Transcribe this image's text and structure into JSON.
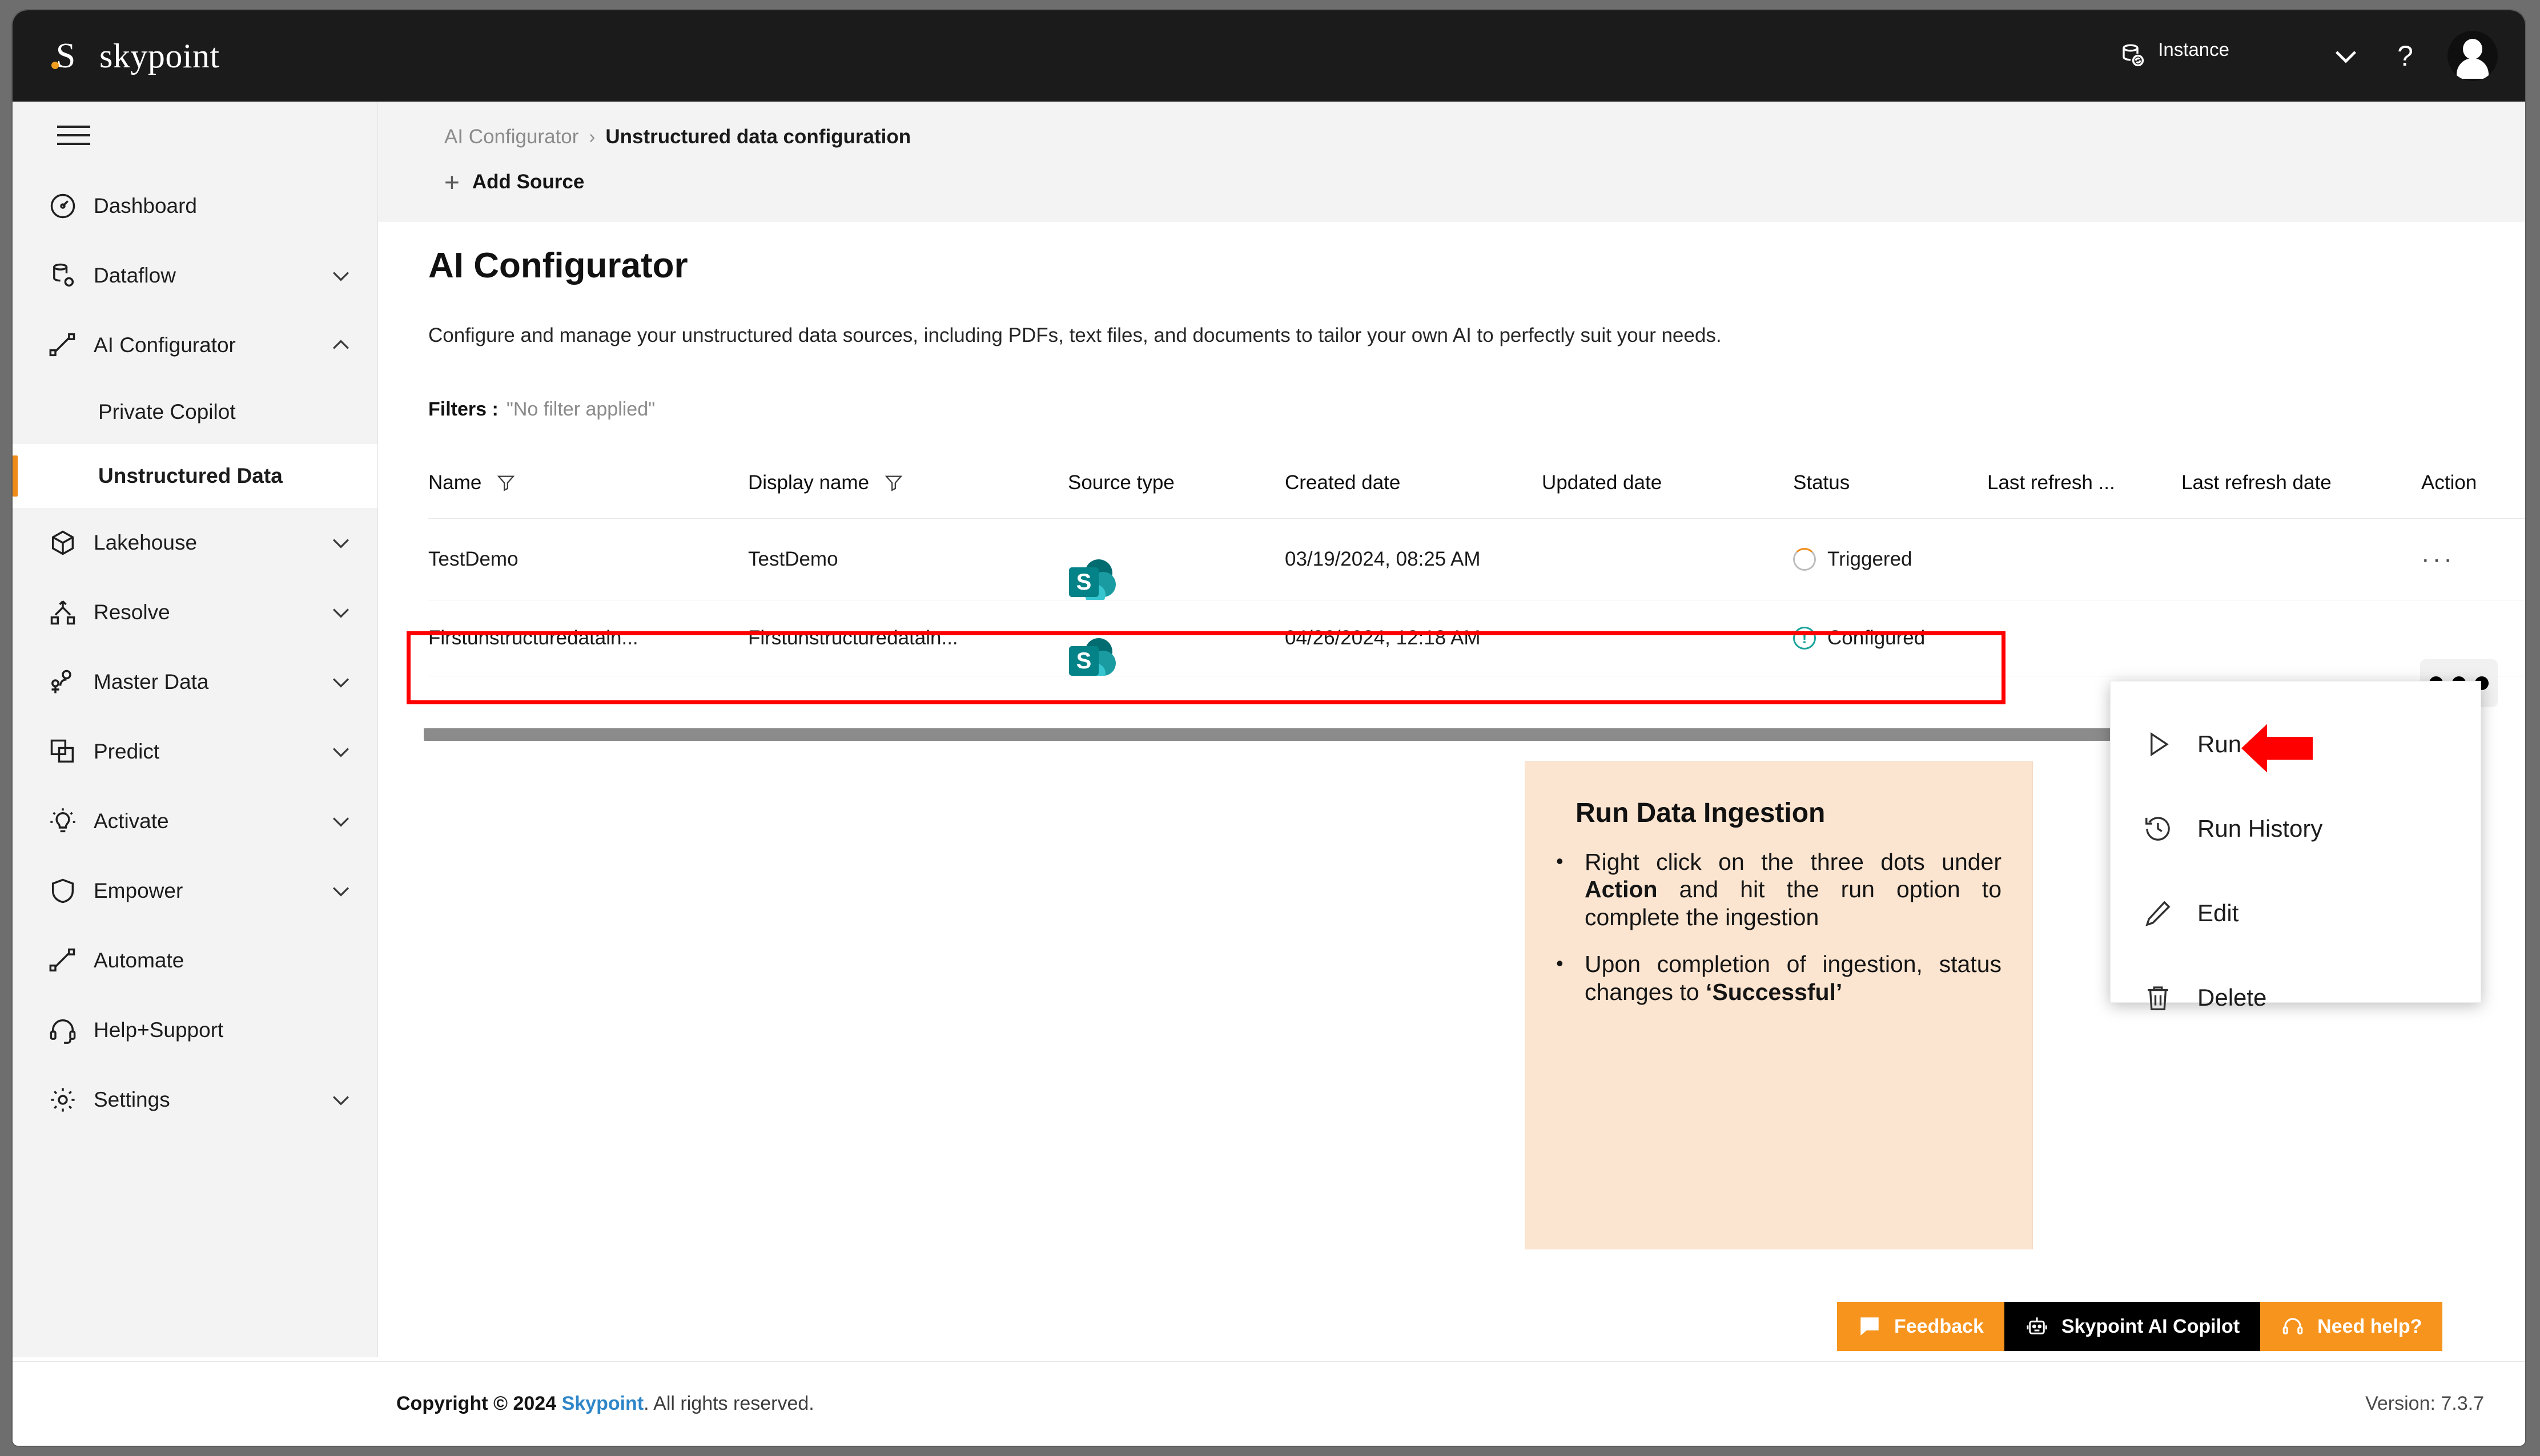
{
  "app": {
    "brand_initial": "S",
    "brand_name": "skypoint"
  },
  "header": {
    "instance_label": "Instance",
    "instance_icon": "database-sync-icon",
    "chevron_icon": "chevron-down-icon",
    "help_glyph": "?",
    "avatar_icon": "user-avatar-icon"
  },
  "sidebar": {
    "menu_icon": "hamburger-icon",
    "items": [
      {
        "label": "Dashboard",
        "icon": "gauge-icon",
        "expandable": false,
        "caret": ""
      },
      {
        "label": "Dataflow",
        "icon": "database-gear-icon",
        "expandable": true,
        "caret": "chevron-down-icon"
      },
      {
        "label": "AI Configurator",
        "icon": "graph-line-icon",
        "expandable": true,
        "caret": "chevron-up-icon"
      },
      {
        "label": "Lakehouse",
        "icon": "cube-icon",
        "expandable": true,
        "caret": "chevron-down-icon"
      },
      {
        "label": "Resolve",
        "icon": "merge-icon",
        "expandable": true,
        "caret": "chevron-down-icon"
      },
      {
        "label": "Master Data",
        "icon": "people-icon",
        "expandable": true,
        "caret": "chevron-down-icon"
      },
      {
        "label": "Predict",
        "icon": "layers-icon",
        "expandable": true,
        "caret": "chevron-down-icon"
      },
      {
        "label": "Activate",
        "icon": "lightbulb-icon",
        "expandable": true,
        "caret": "chevron-down-icon"
      },
      {
        "label": "Empower",
        "icon": "shield-icon",
        "expandable": true,
        "caret": "chevron-down-icon"
      },
      {
        "label": "Automate",
        "icon": "graph-line-icon",
        "expandable": false,
        "caret": ""
      },
      {
        "label": "Help+Support",
        "icon": "headset-icon",
        "expandable": false,
        "caret": ""
      },
      {
        "label": "Settings",
        "icon": "gear-icon",
        "expandable": true,
        "caret": "chevron-down-icon"
      }
    ],
    "sub_items": [
      {
        "label": "Private Copilot",
        "active": false
      },
      {
        "label": "Unstructured Data",
        "active": true
      }
    ]
  },
  "breadcrumb": {
    "parent": "AI Configurator",
    "separator": "›",
    "current": "Unstructured data configuration"
  },
  "toolbar": {
    "add_source_label": "Add Source",
    "add_source_icon": "plus-icon"
  },
  "main": {
    "title": "AI Configurator",
    "description": "Configure and manage your unstructured data sources, including PDFs, text files, and documents to tailor your own AI to perfectly suit your needs.",
    "filters_label": "Filters :",
    "filters_value": "\"No filter applied\""
  },
  "table": {
    "columns": [
      {
        "label": "Name",
        "filterable": true
      },
      {
        "label": "Display name",
        "filterable": true
      },
      {
        "label": "Source type",
        "filterable": false
      },
      {
        "label": "Created date",
        "filterable": false
      },
      {
        "label": "Updated date",
        "filterable": false
      },
      {
        "label": "Status",
        "filterable": false
      },
      {
        "label": "Last refresh ...",
        "filterable": false
      },
      {
        "label": "Last refresh date",
        "filterable": false
      },
      {
        "label": "Action",
        "filterable": false
      }
    ],
    "rows": [
      {
        "name": "TestDemo",
        "display_name": "TestDemo",
        "source_type_icon": "sharepoint-icon",
        "source_type_letter": "S",
        "created_date": "03/19/2024, 08:25 AM",
        "updated_date": "",
        "status": "Triggered",
        "status_icon": "spinner-ring-icon",
        "last_refresh_type": "",
        "last_refresh_date": "",
        "action_icon": "ellipsis-icon",
        "highlighted": false
      },
      {
        "name": "Firstunstructuredatain...",
        "display_name": "Firstunstructuredatain...",
        "source_type_icon": "sharepoint-icon",
        "source_type_letter": "S",
        "created_date": "04/26/2024, 12:18 AM",
        "updated_date": "",
        "status": "Configured",
        "status_icon": "info-circle-icon",
        "last_refresh_type": "",
        "last_refresh_date": "",
        "action_icon": "ellipsis-icon",
        "highlighted": true
      }
    ]
  },
  "context_menu": {
    "items": [
      {
        "label": "Run",
        "icon": "play-icon"
      },
      {
        "label": "Run History",
        "icon": "history-icon"
      },
      {
        "label": "Edit",
        "icon": "pencil-icon"
      },
      {
        "label": "Delete",
        "icon": "trash-icon"
      }
    ]
  },
  "callout": {
    "title": "Run Data Ingestion",
    "bullets": [
      {
        "prefix": "Right click on the three dots under ",
        "bold": "Action",
        "suffix": " and hit the run option to complete the ingestion"
      },
      {
        "prefix": "Upon completion of ingestion, status changes to ",
        "bold": "‘Successful’",
        "suffix": ""
      }
    ]
  },
  "help_bar": {
    "buttons": [
      {
        "label": "Feedback",
        "icon": "comment-icon",
        "style": "orange"
      },
      {
        "label": "Skypoint AI Copilot",
        "icon": "robot-icon",
        "style": "black"
      },
      {
        "label": "Need help?",
        "icon": "headset-icon",
        "style": "orange"
      }
    ]
  },
  "footer": {
    "copyright_prefix": "Copyright © 2024 ",
    "copyright_link": "Skypoint",
    "copyright_suffix": ". All rights reserved.",
    "version": "Version: 7.3.7"
  },
  "colors": {
    "accent_orange": "#f7941d",
    "appbar_black": "#1b1b1b",
    "highlight_red": "#ff0000",
    "callout_bg": "#fce5d0",
    "link_blue": "#2e86c8",
    "status_triggered": "#f08a19",
    "status_configured": "#1aa39a"
  }
}
